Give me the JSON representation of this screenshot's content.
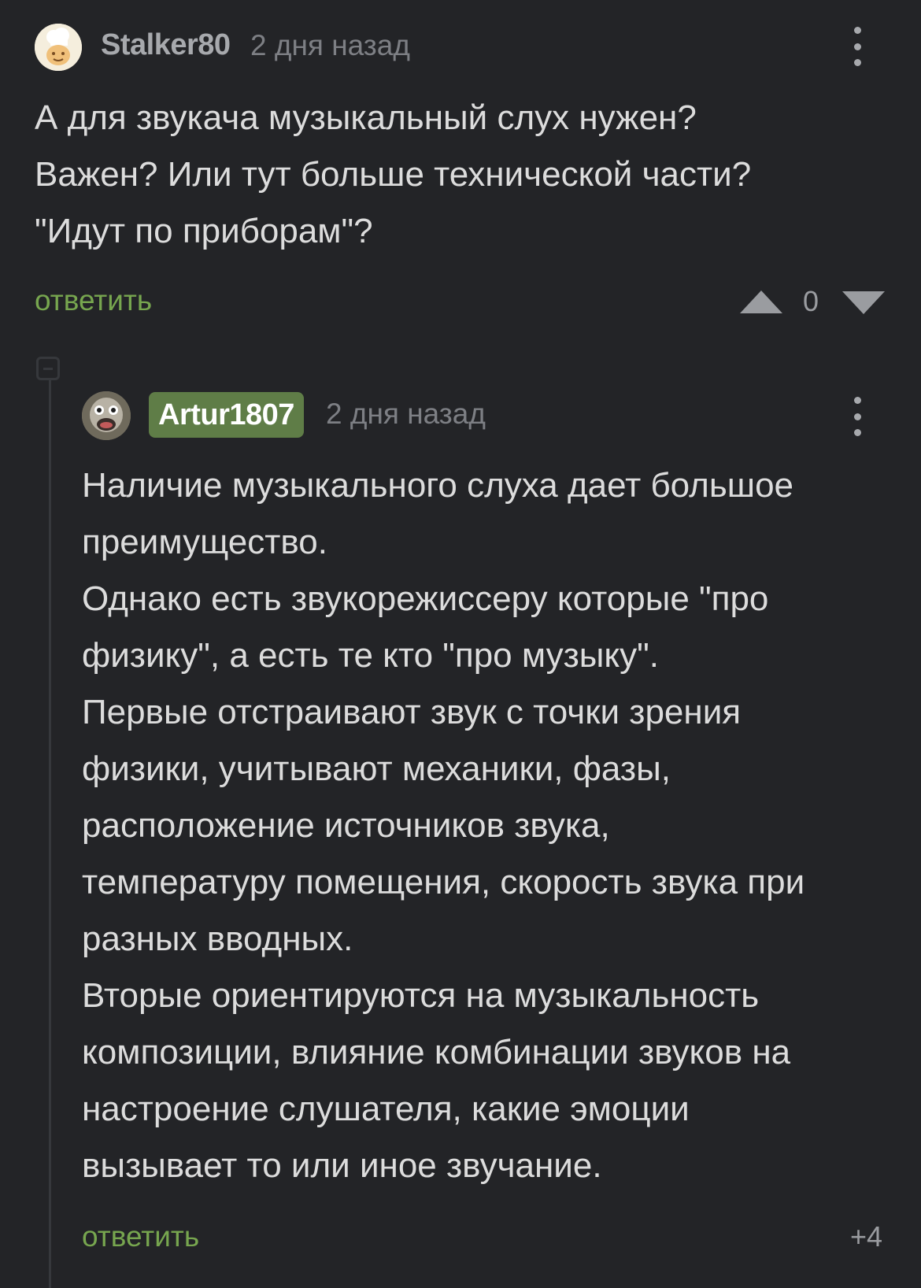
{
  "comment": {
    "username": "Stalker80",
    "timestamp": "2 дня назад",
    "text": "А для звукача музыкальный слух нужен?\nВажен? Или тут больше технической части?\n\"Идут по приборам\"?",
    "reply_label": "ответить",
    "score": "0"
  },
  "reply": {
    "username": "Artur1807",
    "timestamp": "2 дня назад",
    "text": "Наличие музыкального слуха дает большое\nпреимущество.\nОднако есть звукорежиссеру которые \"про\nфизику\", а есть те кто \"про музыку\".\nПервые отстраивают звук с точки зрения\nфизики, учитывают механики, фазы,\nрасположение источников звука,\nтемпературу помещения, скорость звука при\nразных вводных.\nВторые ориентируются на музыкальность\nкомпозиции, влияние комбинации звуков на\nнастроение слушателя, какие эмоции\nвызывает то или иное звучание.",
    "reply_label": "ответить",
    "score": "+4"
  },
  "colors": {
    "background": "#232427",
    "accent_green": "#77a64f",
    "badge_green": "#5f7d47",
    "text": "#dcdcdc",
    "muted": "#7d7f84"
  },
  "icons": {
    "more": "more-vertical-icon",
    "upvote": "triangle-up-icon",
    "downvote": "triangle-down-icon",
    "collapse": "minus-square-icon"
  }
}
